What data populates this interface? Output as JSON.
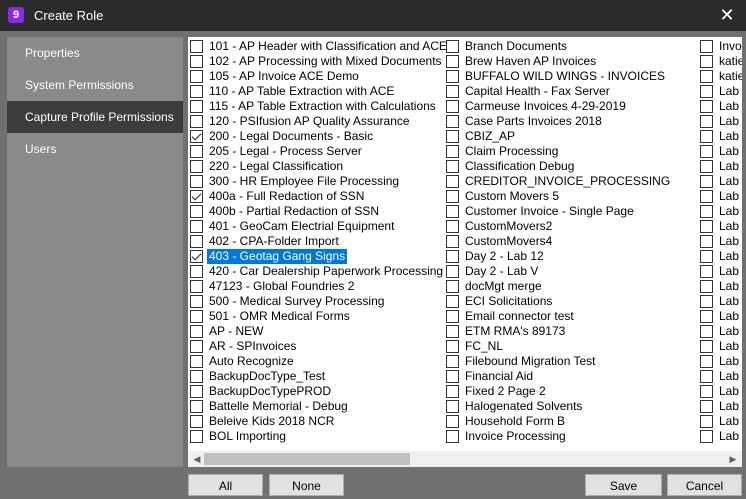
{
  "window": {
    "title": "Create Role",
    "icon_letter": "9"
  },
  "sidebar": {
    "items": [
      {
        "label": "Properties"
      },
      {
        "label": "System Permissions"
      },
      {
        "label": "Capture Profile Permissions",
        "active": true
      },
      {
        "label": "Users"
      }
    ]
  },
  "columns": [
    {
      "items": [
        {
          "label": "101 - AP Header with Classification and ACE",
          "checked": false
        },
        {
          "label": "102 - AP Processing with Mixed Documents",
          "checked": false
        },
        {
          "label": "105 - AP Invoice ACE Demo",
          "checked": false
        },
        {
          "label": "110 - AP Table Extraction with ACE",
          "checked": false
        },
        {
          "label": "115 - AP Table Extraction with Calculations",
          "checked": false
        },
        {
          "label": "120 - PSIfusion AP Quality Assurance",
          "checked": false
        },
        {
          "label": "200 - Legal Documents - Basic",
          "checked": true
        },
        {
          "label": "205 - Legal - Process Server",
          "checked": false
        },
        {
          "label": "220 - Legal Classification",
          "checked": false
        },
        {
          "label": "300 - HR Employee File Processing",
          "checked": false
        },
        {
          "label": "400a - Full Redaction of SSN",
          "checked": true
        },
        {
          "label": "400b - Partial Redaction of SSN",
          "checked": false
        },
        {
          "label": "401 - GeoCam Electrial Equipment",
          "checked": false
        },
        {
          "label": "402 - CPA-Folder Import",
          "checked": false
        },
        {
          "label": "403 - Geotag Gang Signs",
          "checked": true,
          "selected": true
        },
        {
          "label": "420 - Car Dealership Paperwork Processing",
          "checked": false
        },
        {
          "label": "47123 - Global Foundries 2",
          "checked": false
        },
        {
          "label": "500 - Medical Survey Processing",
          "checked": false
        },
        {
          "label": "501 - OMR Medical Forms",
          "checked": false
        },
        {
          "label": "AP - NEW",
          "checked": false
        },
        {
          "label": "AR - SPInvoices",
          "checked": false
        },
        {
          "label": "Auto Recognize",
          "checked": false
        },
        {
          "label": "BackupDocType_Test",
          "checked": false
        },
        {
          "label": "BackupDocTypePROD",
          "checked": false
        },
        {
          "label": "Battelle Memorial - Debug",
          "checked": false
        },
        {
          "label": "Beleive Kids 2018 NCR",
          "checked": false
        },
        {
          "label": "BOL Importing",
          "checked": false
        }
      ]
    },
    {
      "items": [
        {
          "label": "Branch Documents",
          "checked": false
        },
        {
          "label": "Brew Haven AP Invoices",
          "checked": false
        },
        {
          "label": "BUFFALO WILD WINGS - INVOICES",
          "checked": false
        },
        {
          "label": "Capital Health - Fax Server",
          "checked": false
        },
        {
          "label": "Carmeuse Invoices 4-29-2019",
          "checked": false
        },
        {
          "label": "Case Parts Invoices 2018",
          "checked": false
        },
        {
          "label": "CBIZ_AP",
          "checked": false
        },
        {
          "label": "Claim Processing",
          "checked": false
        },
        {
          "label": "Classification Debug",
          "checked": false
        },
        {
          "label": "CREDITOR_INVOICE_PROCESSING",
          "checked": false
        },
        {
          "label": "Custom Movers 5",
          "checked": false
        },
        {
          "label": "Customer Invoice - Single Page",
          "checked": false
        },
        {
          "label": "CustomMovers2",
          "checked": false
        },
        {
          "label": "CustomMovers4",
          "checked": false
        },
        {
          "label": "Day 2 - Lab 12",
          "checked": false
        },
        {
          "label": "Day 2 - Lab V",
          "checked": false
        },
        {
          "label": "docMgt merge",
          "checked": false
        },
        {
          "label": "ECI Solicitations",
          "checked": false
        },
        {
          "label": "Email connector test",
          "checked": false
        },
        {
          "label": "ETM RMA's 89173",
          "checked": false
        },
        {
          "label": "FC_NL",
          "checked": false
        },
        {
          "label": "Filebound Migration Test",
          "checked": false
        },
        {
          "label": "Financial Aid",
          "checked": false
        },
        {
          "label": "Fixed 2 Page 2",
          "checked": false
        },
        {
          "label": "Halogenated Solvents",
          "checked": false
        },
        {
          "label": "Household Form B",
          "checked": false
        },
        {
          "label": "Invoice Processing",
          "checked": false
        }
      ]
    },
    {
      "items": [
        {
          "label": "Invo",
          "checked": false
        },
        {
          "label": "katie",
          "checked": false
        },
        {
          "label": "katie",
          "checked": false
        },
        {
          "label": "Lab",
          "checked": false
        },
        {
          "label": "Lab",
          "checked": false
        },
        {
          "label": "Lab",
          "checked": false
        },
        {
          "label": "Lab",
          "checked": false
        },
        {
          "label": "Lab",
          "checked": false
        },
        {
          "label": "Lab",
          "checked": false
        },
        {
          "label": "Lab",
          "checked": false
        },
        {
          "label": "Lab",
          "checked": false
        },
        {
          "label": "Lab",
          "checked": false
        },
        {
          "label": "Lab",
          "checked": false
        },
        {
          "label": "Lab",
          "checked": false
        },
        {
          "label": "Lab",
          "checked": false
        },
        {
          "label": "Lab",
          "checked": false
        },
        {
          "label": "Lab",
          "checked": false
        },
        {
          "label": "Lab",
          "checked": false
        },
        {
          "label": "Lab",
          "checked": false
        },
        {
          "label": "Lab",
          "checked": false
        },
        {
          "label": "Lab",
          "checked": false
        },
        {
          "label": "Lab",
          "checked": false
        },
        {
          "label": "Lab",
          "checked": false
        },
        {
          "label": "Lab",
          "checked": false
        },
        {
          "label": "Lab",
          "checked": false
        },
        {
          "label": "Lab",
          "checked": false
        },
        {
          "label": "Lab",
          "checked": false
        }
      ]
    }
  ],
  "buttons": {
    "all": "All",
    "none": "None",
    "save": "Save",
    "cancel": "Cancel"
  },
  "scroll": {
    "left_arrow": "◀",
    "right_arrow": "▶"
  },
  "close_glyph": "✕"
}
